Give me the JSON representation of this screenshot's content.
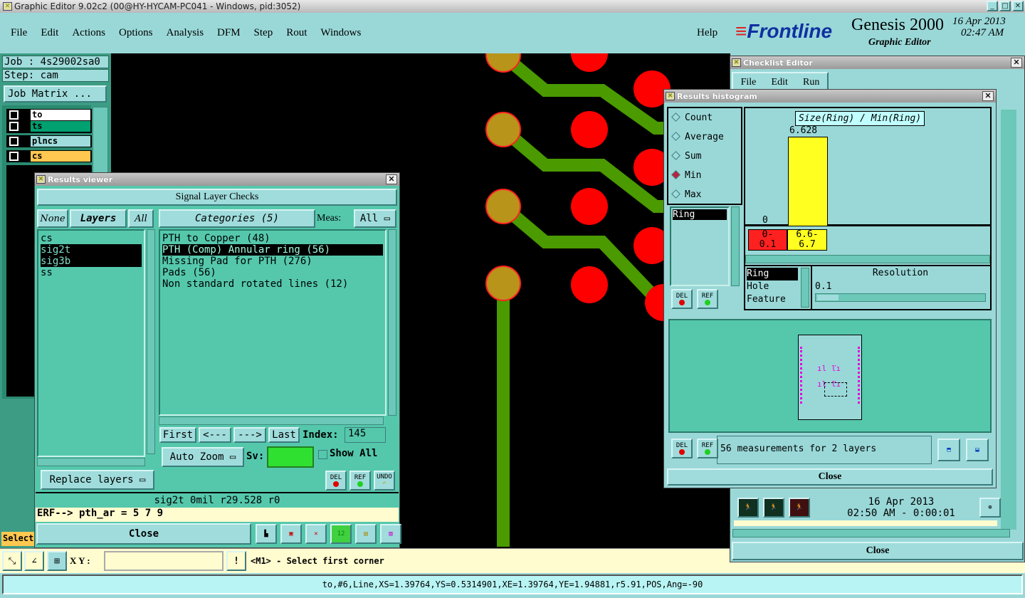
{
  "app": {
    "title": "Graphic Editor 9.02c2 (00@HY-HYCAM-PC041 - Windows, pid:3052)"
  },
  "menu": {
    "items": [
      "File",
      "Edit",
      "Actions",
      "Options",
      "Analysis",
      "DFM",
      "Step",
      "Rout",
      "Windows"
    ],
    "help": "Help"
  },
  "brand": {
    "logo": "Frontline",
    "product": "Genesis 2000",
    "subtitle": "Graphic Editor",
    "date": "16 Apr 2013",
    "time": "02:47 AM"
  },
  "left": {
    "job": "Job : 4s29002sa0",
    "step": "Step: cam",
    "job_matrix": "Job Matrix ...",
    "layers": [
      {
        "name": "to",
        "color": "#ffffff"
      },
      {
        "name": "ts",
        "color": "#00a070"
      },
      {
        "name": "plncs",
        "color": "#a0dcdc"
      },
      {
        "name": "cs",
        "color": "#ffc850"
      }
    ],
    "select_label": "Select"
  },
  "results_viewer": {
    "title": "Results viewer",
    "header": "Signal Layer Checks",
    "none": "None",
    "layers_label": "Layers",
    "all": "All",
    "categories_label": "Categories (5)",
    "meas_label": "Meas:",
    "meas_value": "All",
    "layers": [
      "cs",
      "sig2t",
      "sig3b",
      "ss"
    ],
    "selected_layers": [
      1,
      2
    ],
    "categories": [
      "PTH to Copper (48)",
      "PTH (Comp) Annular ring (56)",
      "Missing Pad for PTH (276)",
      "Pads (56)",
      "Non standard rotated lines (12)"
    ],
    "selected_category": 1,
    "first": "First",
    "prev": "<---",
    "next": "--->",
    "last": "Last",
    "index_label": "Index:",
    "index_value": "145",
    "auto_zoom": "Auto Zoom",
    "sv_label": "Sv:",
    "show_all": "Show All",
    "replace_layers": "Replace layers",
    "del": "DEL",
    "ref": "REF",
    "undo": "UNDO",
    "info": "sig2t 0mil  r29.528  r0",
    "erf": "ERF--> pth_ar = 5 7 9",
    "close": "Close"
  },
  "checklist_editor": {
    "title": "Checklist Editor",
    "menu": [
      "File",
      "Edit",
      "Run"
    ],
    "date": "16 Apr 2013",
    "time": "02:50 AM - 0:00:01",
    "close": "Close"
  },
  "histogram": {
    "title": "Results histogram",
    "modes": [
      "Count",
      "Average",
      "Sum",
      "Min",
      "Max"
    ],
    "selected_mode": 3,
    "measure_list": [
      "Ring"
    ],
    "chart_title": "Size(Ring) / Min(Ring)",
    "bins": [
      {
        "label": "0-\n0.1",
        "value": "0",
        "color": "#ff2020"
      },
      {
        "label": "6.6-\n6.7",
        "value": "6.628",
        "color": "#ffff20"
      }
    ],
    "sort_list": [
      "Ring",
      "Hole",
      "Feature"
    ],
    "resolution_label": "Resolution",
    "resolution_value": "0.1",
    "del": "DEL",
    "ref": "REF",
    "summary": "56 measurements for 2 layers",
    "close": "Close"
  },
  "bottom": {
    "xy_label": "X Y :",
    "xy_value": "",
    "prompt": "<M1> - Select first corner",
    "status": "to,#6,Line,XS=1.39764,YS=0.5314901,XE=1.39764,YE=1.94881,r5.91,POS,Ang=-90"
  }
}
